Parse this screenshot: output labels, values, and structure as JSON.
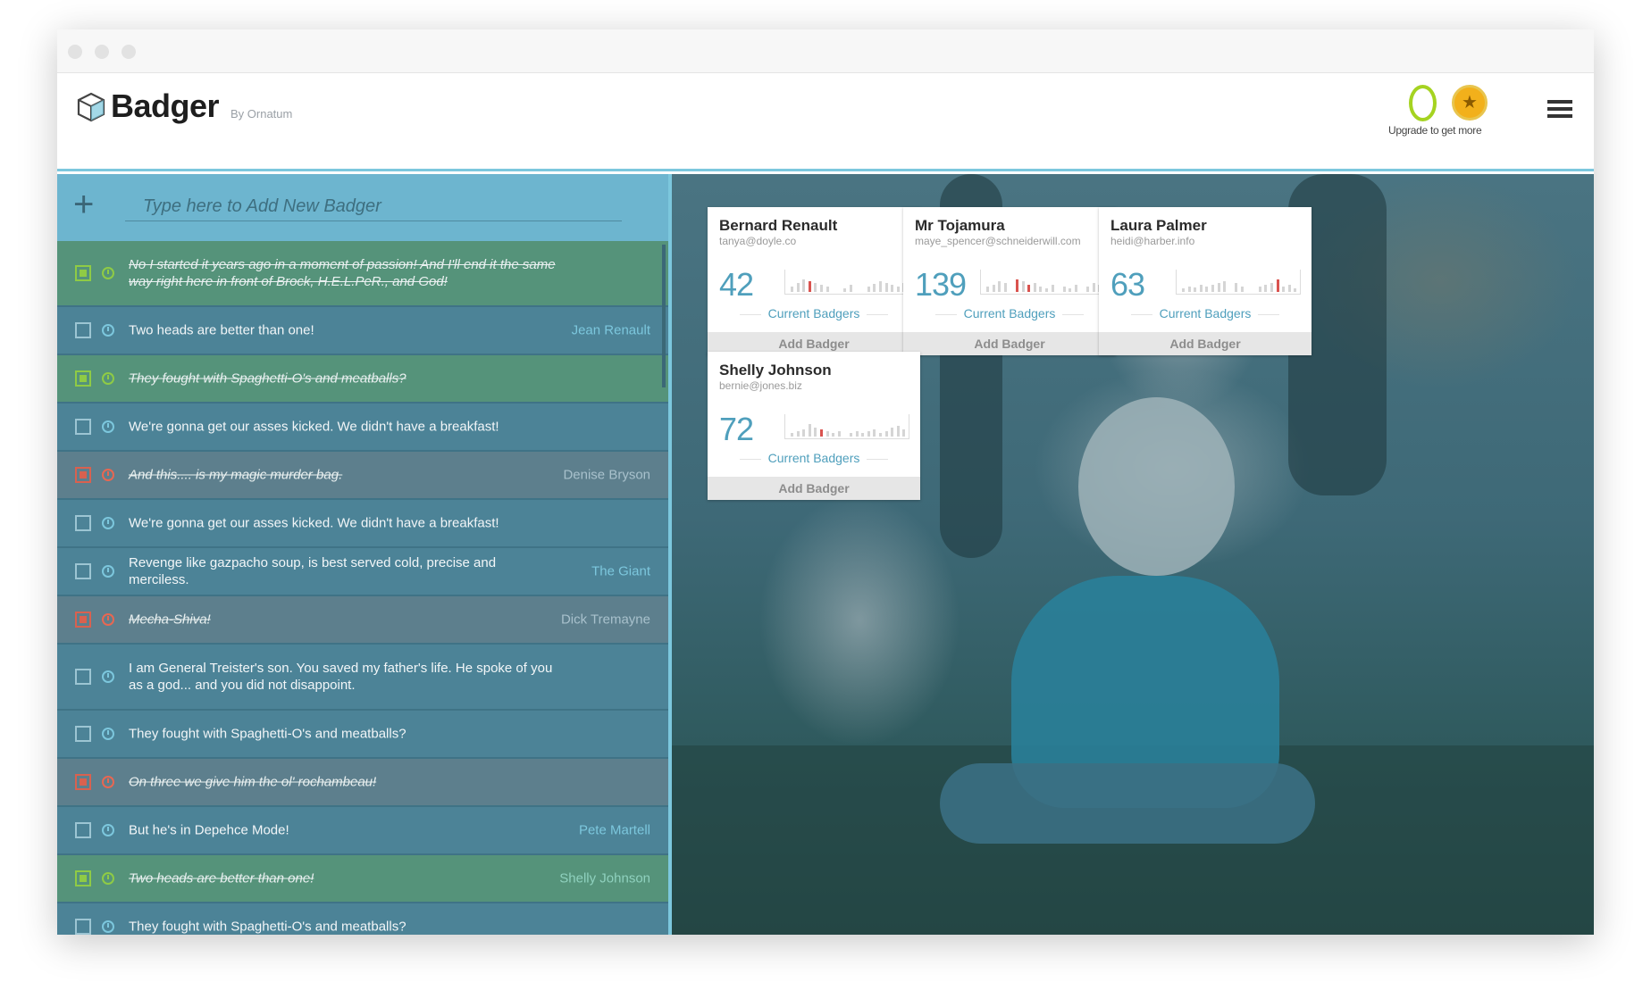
{
  "app": {
    "brand": "Badger",
    "brand_sub": "By Ornatum",
    "upgrade_text": "Upgrade to get more",
    "ring_value": "0"
  },
  "add_bar": {
    "placeholder": "Type here to Add New Badger"
  },
  "tasks": [
    {
      "text": "No I started it years ago in a moment of passion! And I'll end it the same way right here in front of Brock, H.E.L.PeR., and God!",
      "who": "",
      "state": "done-green"
    },
    {
      "text": "Two heads are better than one!",
      "who": "Jean Renault",
      "state": "open"
    },
    {
      "text": "They fought with Spaghetti-O's and meatballs?",
      "who": "",
      "state": "done-green"
    },
    {
      "text": "We're gonna get our asses kicked. We didn't have a breakfast!",
      "who": "",
      "state": "open"
    },
    {
      "text": "And this.... is my magic murder bag.",
      "who": "Denise Bryson",
      "state": "done-red"
    },
    {
      "text": "We're gonna get our asses kicked. We didn't have a breakfast!",
      "who": "",
      "state": "open"
    },
    {
      "text": "Revenge like gazpacho soup, is best served cold, precise and merciless.",
      "who": "The Giant",
      "state": "open"
    },
    {
      "text": "Mecha-Shiva!",
      "who": "Dick Tremayne",
      "state": "done-red"
    },
    {
      "text": "I am General Treister's son. You saved my father's life. He spoke of you as a god... and you did not disappoint.",
      "who": "",
      "state": "open"
    },
    {
      "text": "They fought with Spaghetti-O's and meatballs?",
      "who": "",
      "state": "open"
    },
    {
      "text": "On three we give him the ol' rochambeau!",
      "who": "",
      "state": "done-red"
    },
    {
      "text": "But he's in Depehce Mode!",
      "who": "Pete Martell",
      "state": "open"
    },
    {
      "text": "Two heads are better than one!",
      "who": "Shelly Johnson",
      "state": "done-green"
    },
    {
      "text": "They fought with Spaghetti-O's and meatballs?",
      "who": "",
      "state": "open"
    }
  ],
  "cards": [
    {
      "name": "Bernard Renault",
      "email": "tanya@doyle.co",
      "count": "42",
      "label": "Current Badgers",
      "action": "Add Badger"
    },
    {
      "name": "Mr Tojamura",
      "email": "maye_spencer@schneiderwill.com",
      "count": "139",
      "label": "Current Badgers",
      "action": "Add Badger"
    },
    {
      "name": "Laura Palmer",
      "email": "heidi@harber.info",
      "count": "63",
      "label": "Current Badgers",
      "action": "Add Badger"
    },
    {
      "name": "Shelly Johnson",
      "email": "bernie@jones.biz",
      "count": "72",
      "label": "Current Badgers",
      "action": "Add Badger"
    }
  ],
  "colors": {
    "accent": "#7cc7dd",
    "panel": "#4c8397",
    "done_green": "#55937a",
    "done_red": "#d9614f",
    "count_blue": "#4f9fbc"
  }
}
